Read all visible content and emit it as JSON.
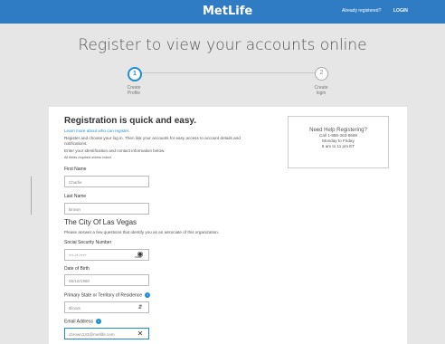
{
  "header": {
    "logo": "MetLife",
    "already_registered": "Already registered?",
    "login": "LOGIN"
  },
  "page": {
    "headline": "Register to view your accounts online"
  },
  "steps": [
    {
      "number": "1",
      "label_line1": "Create",
      "label_line2": "Profile"
    },
    {
      "number": "2",
      "label_line1": "Create",
      "label_line2": "login"
    }
  ],
  "form": {
    "title": "Registration is quick and easy.",
    "learn_more": "Learn more about who can register.",
    "intro1": "Register and choose your log in. Then link your accounts for easy access to account details and",
    "intro2": "notifications.",
    "intro3": "Enter your identification and contact information below.",
    "required_note": "All fields required unless noted",
    "first_name_label": "First Name",
    "first_name_value": "Charlie",
    "last_name_label": "Last Name",
    "last_name_value": "Brown",
    "org_title": "The City Of Las Vegas",
    "org_desc": "Please answer a few questions that identify you as an associate of this organization.",
    "ssn_label": "Social Security Number",
    "ssn_value": "***-**-****",
    "show_label": "Show",
    "dob_label": "Date of Birth",
    "dob_value": "06/16/1960",
    "state_label": "Primary State or Territory of Residence",
    "state_value": "Illinois",
    "email_label": "Email Address",
    "email_value": "cbrown123@metlife.com"
  },
  "help": {
    "title": "Need Help Registering?",
    "phone": "Call 1-866-363-8669",
    "days": "Monday to Friday",
    "hours": "8 am to 11 pm ET"
  }
}
